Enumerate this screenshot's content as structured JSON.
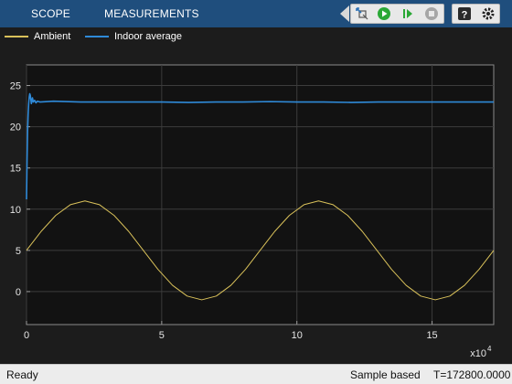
{
  "toolstrip": {
    "tabs": [
      {
        "label": "SCOPE"
      },
      {
        "label": "MEASUREMENTS"
      }
    ],
    "buttons": [
      {
        "icon": "highlight-block-icon",
        "color": "#2f73b7"
      },
      {
        "icon": "run-icon",
        "color": "#2aa836"
      },
      {
        "icon": "step-forward-icon",
        "color": "#2aa836"
      },
      {
        "icon": "stop-icon",
        "color": "#9e9e9e"
      },
      {
        "icon": "help-icon",
        "color": "#222222"
      },
      {
        "icon": "settings-icon",
        "color": "#222222"
      }
    ],
    "bg_color": "#1f4e7d"
  },
  "legend": {
    "items": [
      {
        "label": "Ambient",
        "color": "#d9c15a"
      },
      {
        "label": "Indoor average",
        "color": "#2f8ad8"
      }
    ]
  },
  "chart_data": {
    "type": "line",
    "x_exponent_label": "x10",
    "x_exponent_power": "4",
    "xlim": [
      0,
      17.28
    ],
    "ylim": [
      -4,
      27.5
    ],
    "x_ticks": [
      0,
      5,
      10,
      15
    ],
    "y_ticks": [
      0,
      5,
      10,
      15,
      20,
      25
    ],
    "grid": true,
    "background": "#121212",
    "series": [
      {
        "name": "Ambient",
        "color": "#d9c15a",
        "x": [
          0,
          0.54,
          1.08,
          1.62,
          2.16,
          2.7,
          3.24,
          3.78,
          4.32,
          4.86,
          5.4,
          5.94,
          6.48,
          7.02,
          7.56,
          8.1,
          8.64,
          9.18,
          9.72,
          10.26,
          10.8,
          11.34,
          11.88,
          12.42,
          12.96,
          13.5,
          14.04,
          14.58,
          15.12,
          15.66,
          16.2,
          16.74,
          17.28
        ],
        "y": [
          5.0,
          7.3,
          9.24,
          10.54,
          11.0,
          10.54,
          9.24,
          7.3,
          5.0,
          2.7,
          0.76,
          -0.54,
          -1.0,
          -0.54,
          0.76,
          2.7,
          5.0,
          7.3,
          9.24,
          10.54,
          11.0,
          10.54,
          9.24,
          7.3,
          5.0,
          2.7,
          0.76,
          -0.54,
          -1.0,
          -0.54,
          0.76,
          2.7,
          5.0
        ]
      },
      {
        "name": "Indoor average",
        "color": "#2f8ad8",
        "x": [
          0,
          0.02,
          0.04,
          0.06,
          0.08,
          0.1,
          0.12,
          0.14,
          0.16,
          0.18,
          0.2,
          0.22,
          0.25,
          0.3,
          0.35,
          0.4,
          0.5,
          1,
          2,
          3,
          4,
          5,
          6,
          7,
          8,
          9,
          10,
          11,
          12,
          13,
          14,
          15,
          16,
          17,
          17.28
        ],
        "y": [
          11.2,
          16.0,
          19.5,
          21.5,
          22.8,
          23.6,
          24.0,
          23.8,
          23.3,
          22.8,
          23.2,
          23.5,
          23.0,
          23.2,
          22.9,
          23.1,
          23.0,
          23.1,
          23.0,
          23.0,
          23.0,
          23.0,
          22.95,
          23.0,
          23.0,
          23.05,
          23.0,
          23.0,
          22.95,
          23.0,
          23.0,
          23.0,
          23.0,
          23.0,
          23.0
        ]
      }
    ]
  },
  "status": {
    "state": "Ready",
    "mode": "Sample based",
    "time": "T=172800.0000"
  }
}
